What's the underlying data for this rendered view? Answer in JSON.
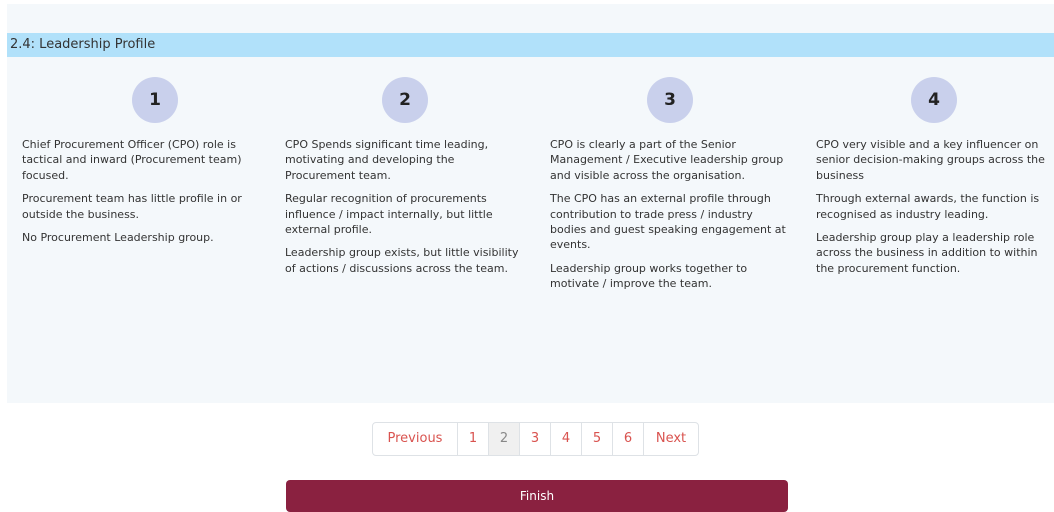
{
  "section": {
    "title": "2.4: Leadership Profile"
  },
  "levels": [
    {
      "number": "1",
      "paragraphs": [
        "Chief Procurement Officer (CPO) role is tactical and inward (Procurement team) focused.",
        "Procurement team has little profile in or outside the business.",
        "No Procurement Leadership group."
      ]
    },
    {
      "number": "2",
      "paragraphs": [
        "CPO Spends significant time leading, motivating and developing the Procurement team.",
        "Regular recognition of procurements influence / impact internally, but little external profile.",
        "Leadership group exists, but little visibility of actions / discussions across the team."
      ]
    },
    {
      "number": "3",
      "paragraphs": [
        "CPO is clearly a part of the Senior Management / Executive leadership group and visible across the organisation.",
        "The CPO has an external profile through contribution to trade press / industry bodies and guest speaking engagement at events.",
        "Leadership group works together to motivate / improve the team."
      ]
    },
    {
      "number": "4",
      "paragraphs": [
        "CPO very visible and a key influencer on senior decision-making groups across the business",
        "Through external awards, the function is recognised as industry leading.",
        "Leadership group play a leadership role across the business in addition to within the procurement function."
      ]
    }
  ],
  "pagination": {
    "previous_label": "Previous",
    "next_label": "Next",
    "pages": [
      "1",
      "2",
      "3",
      "4",
      "5",
      "6"
    ],
    "current_page": "2"
  },
  "finish_label": "Finish",
  "colors": {
    "header_bg": "#b1e1fa",
    "panel_bg": "#f4f8fb",
    "badge_bg": "#c9d0ec",
    "link": "#d9534f",
    "finish_bg": "#8a2140"
  }
}
